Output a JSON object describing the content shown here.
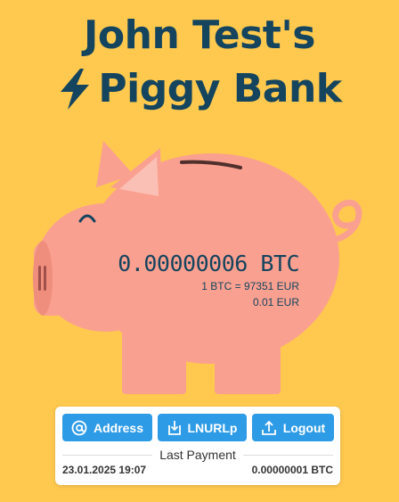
{
  "header": {
    "title_line1": "John Test's",
    "title_line2": "Piggy Bank"
  },
  "balance": {
    "btc": "0.00000006 BTC",
    "rate": "1 BTC = 97351 EUR",
    "fiat": "0.01 EUR"
  },
  "actions": {
    "address_label": "Address",
    "lnurlp_label": "LNURLp",
    "logout_label": "Logout"
  },
  "last_payment": {
    "label": "Last Payment",
    "date": "23.01.2025 19:07",
    "amount": "0.00000001 BTC"
  },
  "colors": {
    "background": "#FFC94F",
    "title": "#14445E",
    "pig_body": "#FAA090",
    "button": "#2E9BE6"
  },
  "icons": {
    "title": "lightning-bolt-icon",
    "address": "at-sign-icon",
    "lnurlp": "download-icon",
    "logout": "upload-icon"
  }
}
